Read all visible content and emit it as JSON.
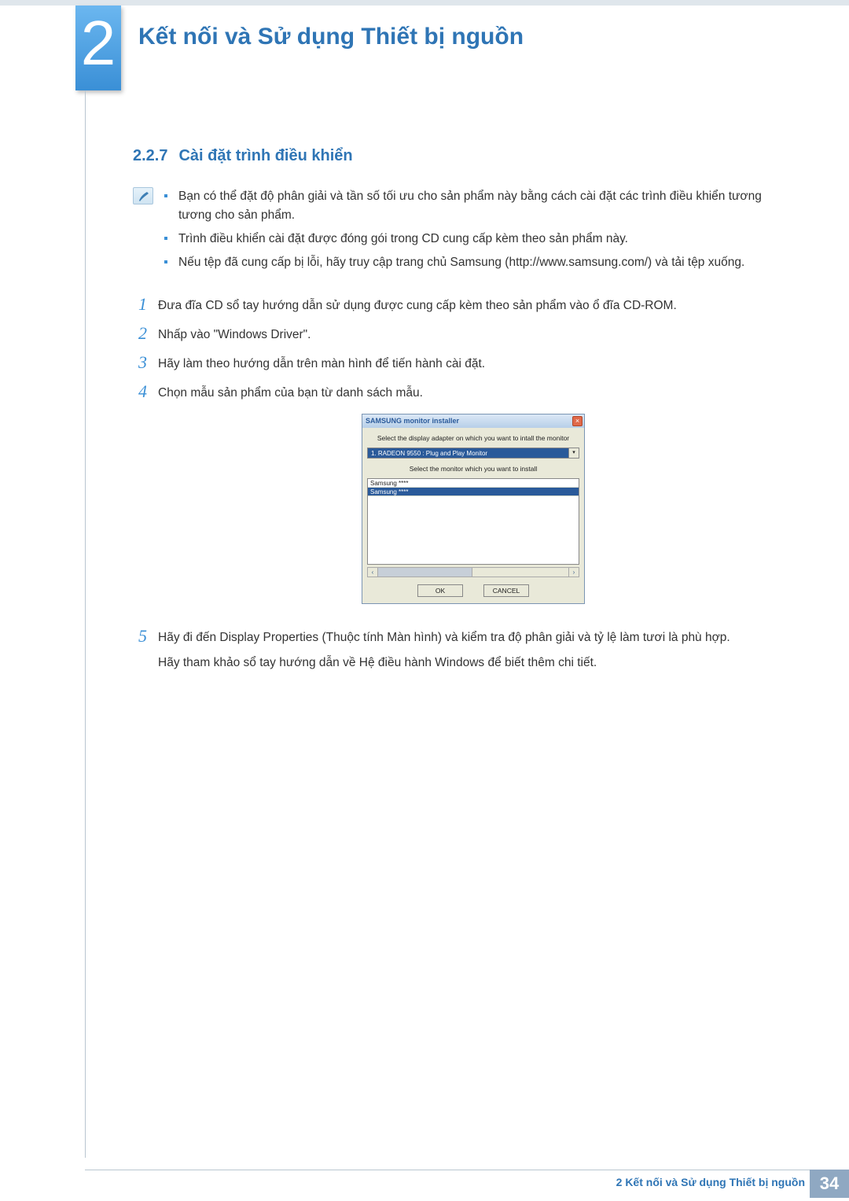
{
  "header": {
    "chapter_number": "2",
    "chapter_title": "Kết nối và Sử dụng Thiết bị nguồn"
  },
  "section": {
    "number": "2.2.7",
    "title": "Cài đặt trình điều khiển"
  },
  "note_bullets": [
    "Bạn có thể đặt độ phân giải và tần số tối ưu cho sản phẩm này bằng cách cài đặt các trình điều khiển tương tương cho sản phẩm.",
    "Trình điều khiển cài đặt được đóng gói trong CD cung cấp kèm theo sản phẩm này.",
    "Nếu tệp đã cung cấp bị lỗi, hãy truy cập trang chủ Samsung (http://www.samsung.com/) và tải tệp xuống."
  ],
  "steps": {
    "s1": {
      "num": "1",
      "text": "Đưa đĩa CD sổ tay hướng dẫn sử dụng được cung cấp kèm theo sản phẩm vào ổ đĩa CD-ROM."
    },
    "s2": {
      "num": "2",
      "text": "Nhấp vào \"Windows Driver\"."
    },
    "s3": {
      "num": "3",
      "text": "Hãy làm theo hướng dẫn trên màn hình để tiến hành cài đặt."
    },
    "s4": {
      "num": "4",
      "text": "Chọn mẫu sản phẩm của bạn từ danh sách mẫu."
    },
    "s5": {
      "num": "5",
      "text": "Hãy đi đến Display Properties (Thuộc tính Màn hình) và kiểm tra độ phân giải và tỷ lệ làm tươi là phù hợp.",
      "text2": "Hãy tham khảo sổ tay hướng dẫn về Hệ điều hành Windows để biết thêm chi tiết."
    }
  },
  "dialog": {
    "title": "SAMSUNG monitor installer",
    "label1": "Select the display adapter on which you want to intall the monitor",
    "combo_value": "1. RADEON 9550 : Plug and Play Monitor",
    "label2": "Select the monitor which you want to install",
    "list_item_1": "Samsung ****",
    "list_item_2": "Samsung ****",
    "close_glyph": "×",
    "combo_glyph": "▾",
    "scroll_left": "‹",
    "scroll_right": "›",
    "ok": "OK",
    "cancel": "CANCEL"
  },
  "footer": {
    "text": "2 Kết nối và Sử dụng Thiết bị nguồn",
    "page": "34"
  }
}
